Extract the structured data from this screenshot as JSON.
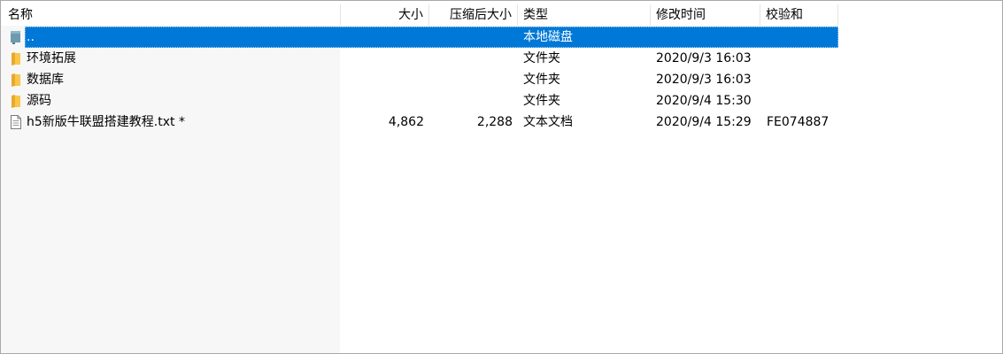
{
  "columns": {
    "name": "名称",
    "size": "大小",
    "packed": "压缩后大小",
    "type": "类型",
    "modified": "修改时间",
    "crc": "校验和"
  },
  "sort_indicator": "^",
  "rows": [
    {
      "icon": "drive-up-icon",
      "name": "..",
      "size": "",
      "packed": "",
      "type": "本地磁盘",
      "modified": "",
      "crc": "",
      "selected": true
    },
    {
      "icon": "folder-icon",
      "name": "环境拓展",
      "size": "",
      "packed": "",
      "type": "文件夹",
      "modified": "2020/9/3 16:03",
      "crc": ""
    },
    {
      "icon": "folder-icon",
      "name": "数据库",
      "size": "",
      "packed": "",
      "type": "文件夹",
      "modified": "2020/9/3 16:03",
      "crc": ""
    },
    {
      "icon": "folder-icon",
      "name": "源码",
      "size": "",
      "packed": "",
      "type": "文件夹",
      "modified": "2020/9/4 15:30",
      "crc": ""
    },
    {
      "icon": "text-file-icon",
      "name": "h5新版牛联盟搭建教程.txt *",
      "size": "4,862",
      "packed": "2,288",
      "type": "文本文档",
      "modified": "2020/9/4 15:29",
      "crc": "FE074887"
    }
  ],
  "colors": {
    "selection": "#0078d7",
    "folder": "#f8c64a",
    "name_column_bg": "#f7f7f7",
    "border": "#a9a9a9"
  }
}
